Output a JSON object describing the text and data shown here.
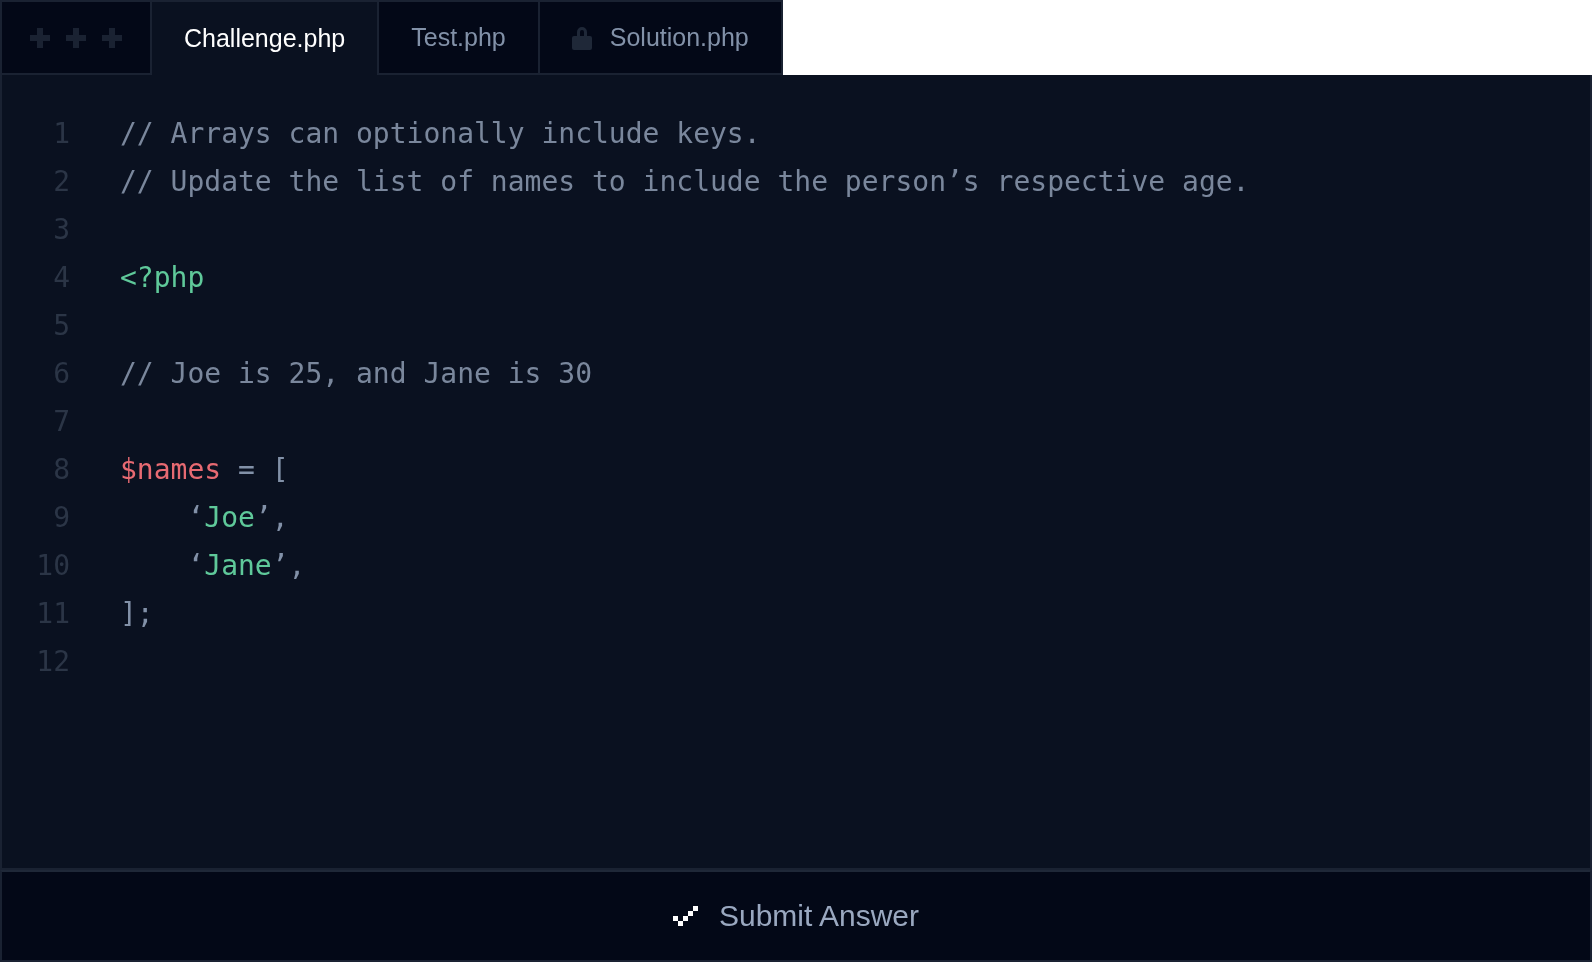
{
  "tabs": [
    {
      "label": "Challenge.php",
      "selected": true,
      "locked": false
    },
    {
      "label": "Test.php",
      "selected": false,
      "locked": false
    },
    {
      "label": "Solution.php",
      "selected": false,
      "locked": true
    }
  ],
  "editor": {
    "lines": [
      {
        "number": "1",
        "tokens": [
          {
            "kind": "comment",
            "text": "// Arrays can optionally include keys."
          }
        ]
      },
      {
        "number": "2",
        "tokens": [
          {
            "kind": "comment",
            "text": "// Update the list of names to include the person’s respective age."
          }
        ]
      },
      {
        "number": "3"
      },
      {
        "number": "4",
        "tokens": [
          {
            "kind": "tag",
            "text": "<?php"
          }
        ]
      },
      {
        "number": "5"
      },
      {
        "number": "6",
        "tokens": [
          {
            "kind": "comment",
            "text": "// Joe is 25, and Jane is 30"
          }
        ]
      },
      {
        "number": "7"
      },
      {
        "number": "8",
        "tokens": [
          {
            "kind": "variable",
            "text": "$names"
          },
          {
            "kind": "punct",
            "text": " = ["
          }
        ]
      },
      {
        "number": "9",
        "tokens": [
          {
            "kind": "punct",
            "text": "    ‘"
          },
          {
            "kind": "string",
            "text": "Joe"
          },
          {
            "kind": "punct",
            "text": "’,"
          }
        ]
      },
      {
        "number": "10",
        "tokens": [
          {
            "kind": "punct",
            "text": "    ‘"
          },
          {
            "kind": "string",
            "text": "Jane"
          },
          {
            "kind": "punct",
            "text": "’,"
          }
        ]
      },
      {
        "number": "11",
        "tokens": [
          {
            "kind": "punct",
            "text": "];"
          }
        ]
      },
      {
        "number": "12"
      }
    ]
  },
  "submit_button": {
    "label": "Submit Answer"
  }
}
